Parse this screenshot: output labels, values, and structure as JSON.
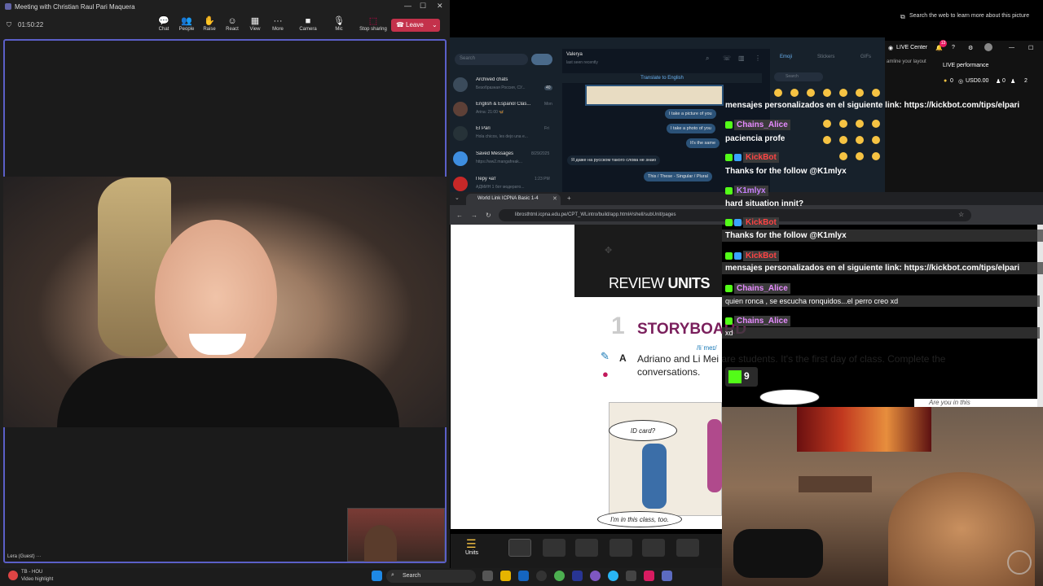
{
  "teams": {
    "title": "Meeting with Christian Raul Pari Maquera",
    "timer": "01:50:22",
    "toolbar": [
      {
        "label": "Chat",
        "icon": "chat-icon"
      },
      {
        "label": "People",
        "icon": "people-icon",
        "count": "2"
      },
      {
        "label": "Raise",
        "icon": "raise-hand-icon"
      },
      {
        "label": "React",
        "icon": "react-icon"
      },
      {
        "label": "View",
        "icon": "view-icon"
      },
      {
        "label": "More",
        "icon": "more-icon"
      },
      {
        "label": "Camera",
        "icon": "camera-icon"
      },
      {
        "label": "Mic",
        "icon": "mic-icon"
      },
      {
        "label": "Stop sharing",
        "icon": "share-icon"
      }
    ],
    "leave": "Leave",
    "participant_label": "Lera (Guest)",
    "participant_more": "···"
  },
  "taskbar": {
    "weather_temp": "TB - HOU",
    "weather_sub": "Video highlight",
    "search": "Search"
  },
  "telegram": {
    "search_placeholder": "Search",
    "contact_name": "Valerya",
    "contact_status": "last seen recently",
    "translate": "Translate to English",
    "chats": [
      {
        "name": "Archived chats",
        "msg": "Безобразная Россия, СУ...",
        "time": "",
        "badge": "40"
      },
      {
        "name": "English & Español Clas...",
        "msg": "Arina: 21:00 🦋",
        "time": "Mon",
        "badge": ""
      },
      {
        "name": "El Pari",
        "msg": "Hola chicos, les dejo una e...",
        "time": "Fri",
        "badge": ""
      },
      {
        "name": "Saved Messages",
        "msg": "https://ww2.mangafreak...",
        "time": "8/29/2025",
        "badge": ""
      },
      {
        "name": "Перу чат",
        "msg": "АДМИН 1 бот модерато...",
        "time": "1:23 PM",
        "badge": "1422"
      }
    ],
    "messages": [
      {
        "text": "I take a picture of you",
        "side": "out"
      },
      {
        "text": "I take a photo of you",
        "side": "out"
      },
      {
        "text": "It's the same",
        "side": "out"
      },
      {
        "text": "Я даже на русском такого слова не знаю",
        "side": "in",
        "time": "12:38 PM"
      },
      {
        "text": "This / These - Singular / Plural",
        "side": "out"
      }
    ],
    "emoji_tabs": [
      "Emoji",
      "Stickers",
      "GIFs"
    ],
    "emoji_search": "Search"
  },
  "browser": {
    "tab_title": "World Link ICPNA Basic 1-4",
    "url": "librosthtml.icpna.edu.pe/CPT_WLintro/build/app.html#/shell/subUnit/pages"
  },
  "book": {
    "review": "REVIEW",
    "units": "UNITS",
    "number": "1",
    "storyboard": "STORYBOARD",
    "phonetic": "/liˈmeɪ/",
    "letter": "A",
    "instruction": "Adriano and Li Mei are students. It's the first day of class. Complete the conversations.",
    "bubble1": "ID card?",
    "bubble2": "I'm in this class, too.",
    "bubble3": "Are you in this",
    "units_label": "Units"
  },
  "stream_chat": [
    {
      "user": "",
      "text": "mensajes personalizados en el siguiente link: https://kickbot.com/tips/elpari"
    },
    {
      "user": "Chains_Alice",
      "text": "paciencia profe",
      "kind": "alice"
    },
    {
      "user": "KickBot",
      "text": "Thanks for the follow @K1mlyx",
      "kind": "kick"
    },
    {
      "user": "K1mlyx",
      "text": "hard situation innit?",
      "kind": "k1"
    },
    {
      "user": "KickBot",
      "text": "Thanks for the follow @K1mlyx",
      "kind": "kick"
    },
    {
      "user": "KickBot",
      "text": "mensajes personalizados en el siguiente link: https://kickbot.com/tips/elpari",
      "kind": "kick"
    },
    {
      "user": "Chains_Alice",
      "text": "quien ronca , se escucha ronquidos...el perro creo xd",
      "kind": "alice"
    },
    {
      "user": "Chains_Alice",
      "text": "xd",
      "kind": "alice"
    }
  ],
  "viewer_count": "9",
  "overlay": {
    "lens_tip": "Search the web to learn more about this picture",
    "live_center": "LIVE Center",
    "notif_count": "13",
    "live_perf": "LIVE performance",
    "stat1": "0",
    "stat2": "USD0.00",
    "stat3": "0",
    "stat4": "2",
    "layout_hint": "amline your layout"
  }
}
